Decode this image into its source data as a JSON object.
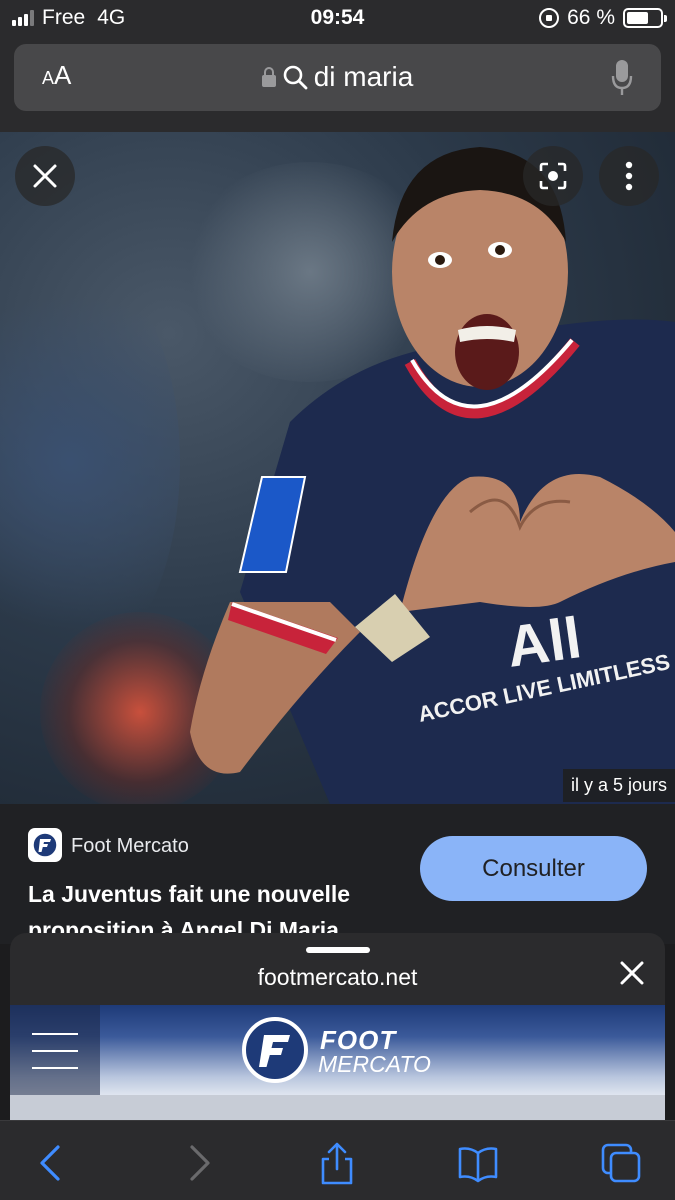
{
  "status_bar": {
    "carrier": "Free",
    "network": "4G",
    "time": "09:54",
    "battery_percent": "66 %",
    "battery_level": 0.66
  },
  "address_bar": {
    "text_size_label": "AA",
    "url_text": "di maria",
    "icons": [
      "padlock-icon",
      "search-icon",
      "mic-icon"
    ]
  },
  "image_viewer": {
    "close_icon": "close-icon",
    "lens_icon": "lens-icon",
    "more_icon": "more-vert-icon",
    "timestamp": "il y a 5 jours"
  },
  "result": {
    "source": "Foot Mercato",
    "headline": "La Juventus fait une nouvelle proposition à Angel Di Maria",
    "action_label": "Consulter"
  },
  "sheet": {
    "domain": "footmercato.net",
    "site_logo_line1": "FOOT",
    "site_logo_line2": "MERCATO"
  },
  "toolbar": {
    "icons": [
      "back-icon",
      "forward-icon",
      "share-icon",
      "bookmarks-icon",
      "tabs-icon"
    ]
  },
  "colors": {
    "accent_button": "#8ab4f8",
    "site_blue": "#1e3a78"
  }
}
